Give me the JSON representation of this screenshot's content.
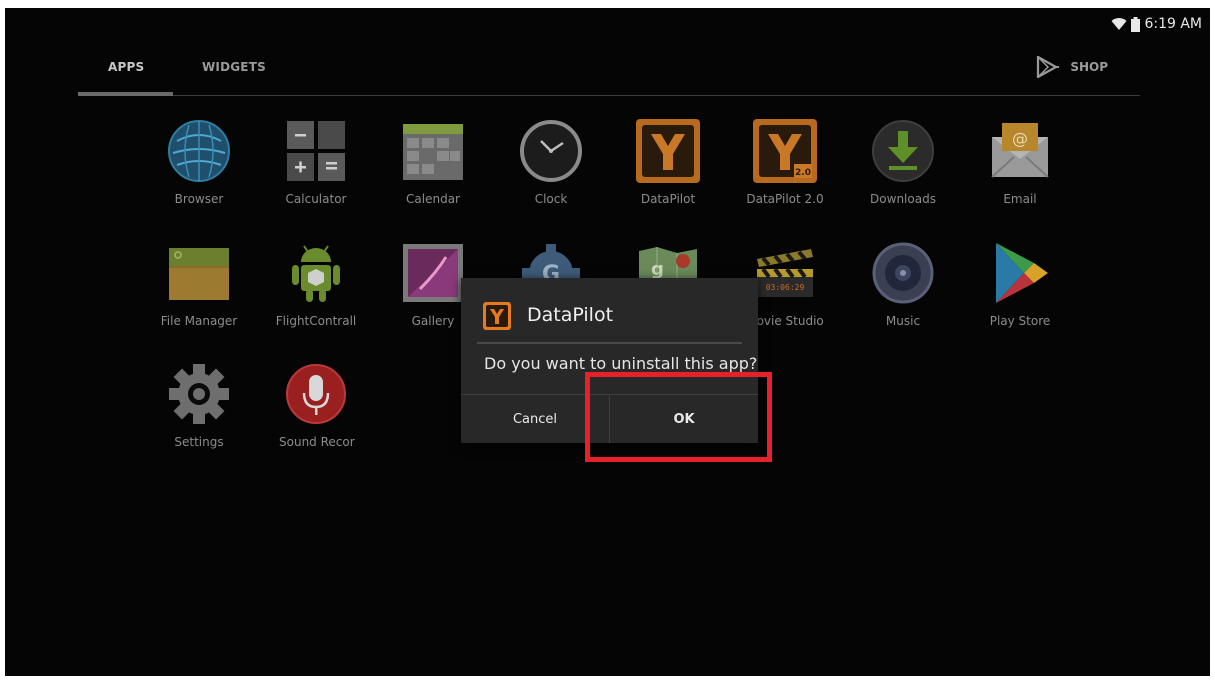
{
  "status_bar": {
    "time": "6:19 AM"
  },
  "tabs": {
    "apps": "APPS",
    "widgets": "WIDGETS",
    "shop": "SHOP"
  },
  "apps": [
    {
      "label": "Browser",
      "icon": "globe-icon"
    },
    {
      "label": "Calculator",
      "icon": "calculator-icon"
    },
    {
      "label": "Calendar",
      "icon": "calendar-icon"
    },
    {
      "label": "Clock",
      "icon": "clock-icon"
    },
    {
      "label": "DataPilot",
      "icon": "datapilot-icon"
    },
    {
      "label": "DataPilot 2.0",
      "icon": "datapilot2-icon",
      "badge": "2.0"
    },
    {
      "label": "Downloads",
      "icon": "download-icon"
    },
    {
      "label": "Email",
      "icon": "envelope-icon"
    },
    {
      "label": "File Manager",
      "icon": "folder-icon"
    },
    {
      "label": "FlightContrall",
      "icon": "android-icon"
    },
    {
      "label": "Gallery",
      "icon": "gallery-icon"
    },
    {
      "label": "",
      "icon": "google-settings-icon"
    },
    {
      "label": "",
      "icon": "maps-icon"
    },
    {
      "label": "Movie Studio",
      "icon": "clapperboard-icon",
      "badge": "03:06:29"
    },
    {
      "label": "Music",
      "icon": "speaker-icon"
    },
    {
      "label": "Play Store",
      "icon": "play-store-icon"
    },
    {
      "label": "Settings",
      "icon": "gear-icon"
    },
    {
      "label": "Sound Recorder",
      "icon": "microphone-icon"
    }
  ],
  "dialog": {
    "title": "DataPilot",
    "message": "Do you want to uninstall this app?",
    "cancel_label": "Cancel",
    "ok_label": "OK"
  },
  "colors": {
    "highlight": "#e8202a",
    "dialog_bg": "#282828",
    "accent_orange": "#e87a1e"
  }
}
